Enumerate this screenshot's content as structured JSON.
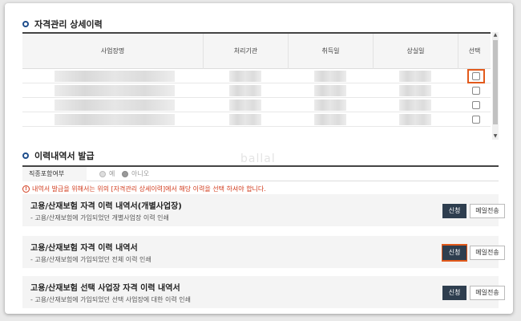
{
  "history": {
    "title": "자격관리 상세이력",
    "columns": [
      "사업장명",
      "처리기관",
      "취득일",
      "상실일",
      "선택"
    ]
  },
  "issue": {
    "title": "이력내역서 발급",
    "include": {
      "label": "직종포함여부",
      "options": [
        "예",
        "아니오"
      ],
      "selected": "아니오"
    },
    "notice": "내역서 발급을 위해서는 위의 [자격관리 상세이력]에서 해당 이력을 선택 하셔야 합니다.",
    "cards": [
      {
        "title": "고용/산재보험 자격 이력 내역서(개별사업장)",
        "desc": "- 고용/산재보험에 가입되었던 개별사업장 이력 인쇄",
        "apply": "신청",
        "mail": "메일전송"
      },
      {
        "title": "고용/산재보험 자격 이력 내역서",
        "desc": "- 고용/산재보험에 가입되었던 전체 이력 인쇄",
        "apply": "신청",
        "mail": "메일전송"
      },
      {
        "title": "고용/산재보험 선택 사업장 자격 이력 내역서",
        "desc": "- 고용/산재보험에 가입되었던 선택 사업장에 대한 이력 인쇄",
        "apply": "신청",
        "mail": "메일전송"
      }
    ]
  },
  "watermark": "ballal",
  "colors": {
    "accent": "#1f4e8c",
    "highlight": "#e25a1c",
    "button": "#2e3e4f",
    "notice": "#d23c1e"
  }
}
